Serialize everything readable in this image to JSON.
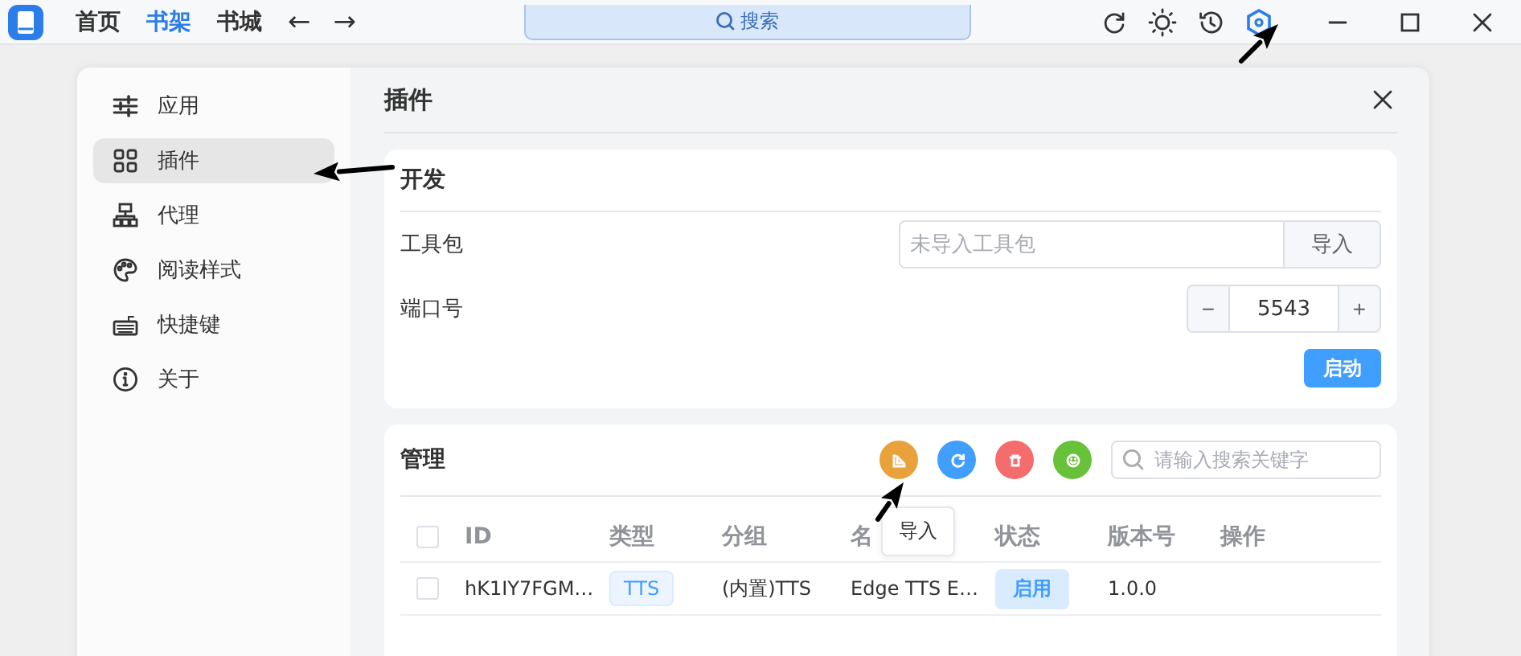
{
  "app_bar": {
    "nav": [
      {
        "label": "首页",
        "selected": false
      },
      {
        "label": "书架",
        "selected": true
      },
      {
        "label": "书城",
        "selected": false
      }
    ],
    "back": "←",
    "forward": "→",
    "search": {
      "placeholder": "搜索"
    }
  },
  "dialog": {
    "title": "插件",
    "sidebar": {
      "items": [
        {
          "label": "应用",
          "selected": false
        },
        {
          "label": "插件",
          "selected": true
        },
        {
          "label": "代理",
          "selected": false
        },
        {
          "label": "阅读样式",
          "selected": false
        },
        {
          "label": "快捷键",
          "selected": false
        },
        {
          "label": "关于",
          "selected": false
        }
      ]
    },
    "develop": {
      "title": "开发",
      "toolkit": {
        "label": "工具包",
        "placeholder": "未导入工具包",
        "button": "导入"
      },
      "port": {
        "label": "端口号",
        "minus": "−",
        "value": "5543",
        "plus": "+"
      },
      "start_button": "启动"
    },
    "manage": {
      "title": "管理",
      "search": {
        "placeholder": "请输入搜索关键字"
      },
      "tooltip": "导入",
      "table": {
        "select_all": {
          "checked": false
        },
        "columns": [
          "ID",
          "类型",
          "分组",
          "名",
          "状态",
          "版本号",
          "操作"
        ],
        "rows": [
          {
            "checked": false,
            "id": "hK1IY7FGM…",
            "type": "TTS",
            "group": "(内置)TTS",
            "name": "Edge TTS E…",
            "status": "启用",
            "version": "1.0.0"
          }
        ]
      }
    }
  }
}
